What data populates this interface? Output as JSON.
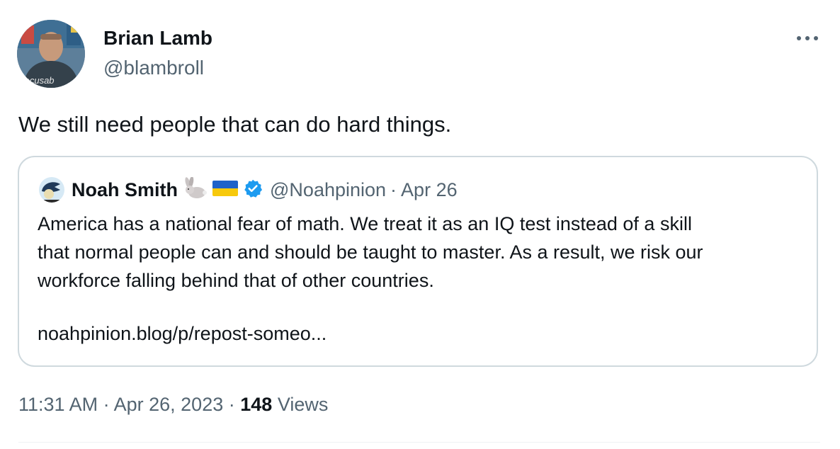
{
  "author": {
    "display_name": "Brian Lamb",
    "handle": "@blambroll",
    "avatar_shirt_text": "focusable"
  },
  "tweet": {
    "text": "We still need people that can do hard things."
  },
  "quoted_tweet": {
    "display_name": "Noah Smith",
    "name_emojis": [
      "rabbit-emoji",
      "ukraine-flag-emoji"
    ],
    "verified": true,
    "handle": "@Noahpinion",
    "separator": "·",
    "date": "Apr 26",
    "body_lines": [
      "America has a national fear of math. We treat it as an IQ test instead of a skill",
      "that normal people can and should be taught to master. As a result, we risk our",
      "workforce falling behind that of other countries."
    ],
    "link": "noahpinion.blog/p/repost-someo..."
  },
  "meta": {
    "time": "11:31 AM",
    "separator": "·",
    "date": "Apr 26, 2023",
    "views_count": "148",
    "views_label": "Views"
  },
  "icons": {
    "more": "more-horizontal-icon",
    "verified": "verified-badge-icon"
  },
  "colors": {
    "text_primary": "#0f1419",
    "text_secondary": "#536471",
    "border": "#cfd9de",
    "verified_blue": "#1d9bf0"
  }
}
